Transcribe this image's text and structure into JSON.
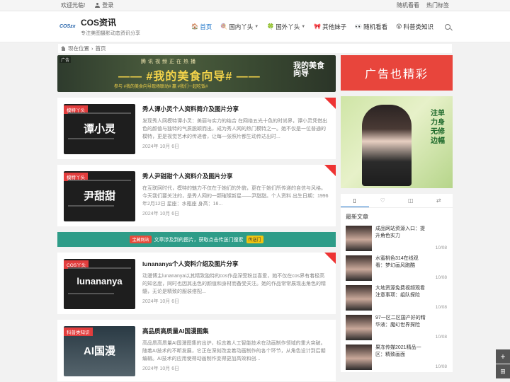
{
  "topbar": {
    "welcome": "欢迎光临!",
    "login": "登录",
    "links": [
      "随机看看",
      "热门标签"
    ]
  },
  "logo": {
    "mark": "COSzx",
    "title": "COS资讯",
    "subtitle": "专注美图摄影动态资讯分享"
  },
  "nav": [
    {
      "emoji": "🏠",
      "label": "首页",
      "active": true,
      "caret": false
    },
    {
      "emoji": "🍭",
      "label": "国内丫头",
      "active": false,
      "caret": true
    },
    {
      "emoji": "🍀",
      "label": "国外丫头",
      "active": false,
      "caret": true
    },
    {
      "emoji": "🎀",
      "label": "其他妹子",
      "active": false,
      "caret": false
    },
    {
      "emoji": "👀",
      "label": "随机看看",
      "active": false,
      "caret": false
    },
    {
      "emoji": "😲",
      "label": "科普类知识",
      "active": false,
      "caret": false
    }
  ],
  "breadcrumb": {
    "current_label": "现在位置",
    "home": "首页"
  },
  "banner": {
    "ad_tag": "广告",
    "top_text": "腾讯视频正在热播",
    "main_text": "—— #我的美食向导# ——",
    "sub_text": "参与 #我的美食向导现场联动# 赢 #我们一起吃饭#",
    "logo_text": "我的美食向导"
  },
  "posts": [
    {
      "category": "模特丫头",
      "thumb_text": "谭小灵",
      "title": "秀人谭小灵个人资料简介及图片分享",
      "excerpt": "发现秀人网模特谭小灵：美丽与实力的结合 在网络五光十色的时尚界，谭小灵凭借出色的颜值与独特的气质脱颖而出，成为秀人网的热门模特之一。她不仅是一位普通的模特，更是视觉艺术的传递者，让每一张照片都生动传达出时...",
      "date": "2024年 10月 6日"
    },
    {
      "category": "模特丫头",
      "thumb_text": "尹甜甜",
      "title": "秀人尹甜甜个人资料介及图片分享",
      "excerpt": "在互联网时代，模特的魅力不仅在于她们的外貌，更在于她们所传递的自信与风格。今天我们要关注的，是秀人网的一颗璀璨新星——尹甜甜。个人资料 出生日期：1996年2月12日 星座：水瓶座 身高：16...",
      "date": "2024年 10月 6日"
    }
  ],
  "promo": {
    "tag1": "宝藏网站",
    "text": "文章涉及到的图片，获取点击传送门搜索",
    "tag2": "传送门"
  },
  "posts2": [
    {
      "category": "COS丫头",
      "thumb_text": "lunananya",
      "title": "lunananya个人资料介绍及图片分享",
      "excerpt": "动漫博主lunananya以其精致独特的cos作品深受粉丝喜爱，她不仅在cos界有着极高的知名度，同时也因其出色的颜值和身材而备受关注。她的作品常常展现出角色的精髓，无论是精致的服装搭配...",
      "date": "2024年 10月 6日"
    },
    {
      "category": "科普类知识",
      "thumb_text": "AI国漫",
      "title": "高品质高质量AI国漫图集",
      "excerpt": "高品质高质量AI国漫图集的出炉，标志着人工智能技术在动画制作领域的重大突破。随着AI技术的不断发展，它正在深刻改变着动画制作的各个环节，从角色设计到后期编辑。AI技术的应用使得动画制作变得更加高效和创...",
      "date": "2024年 10月 6日"
    }
  ],
  "sidebar": {
    "ad1_text": "广告也精彩",
    "ad2_stamp": "注单力身无修边幅",
    "recent_title": "最新文章",
    "recent": [
      {
        "title": "成品网站资源入口：提升角色实力",
        "date": "10/08"
      },
      {
        "title": "水蜜桃色314在线观看：梦幻画风跑酷",
        "date": "10/08"
      },
      {
        "title": "大地资源免费视频观看注意事项：组队探险",
        "date": "10/08"
      },
      {
        "title": "97一区二区国产好的精华液：魔幻世界探险",
        "date": "10/08"
      },
      {
        "title": "果冻传媒2021精品一区：精致画面",
        "date": "10/08"
      }
    ]
  },
  "colors": {
    "accent": "#1a73c9",
    "red": "#e23d3d",
    "teal": "#2e9c88"
  }
}
